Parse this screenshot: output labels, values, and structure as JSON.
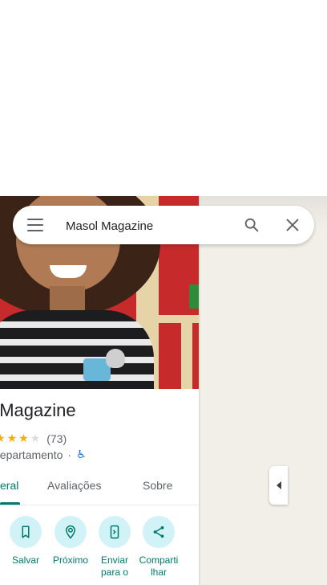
{
  "search": {
    "query": "Masol Magazine",
    "menu_icon": "hamburger-menu-icon",
    "search_icon": "search-icon",
    "clear_icon": "close-icon"
  },
  "place": {
    "name": "ol Magazine",
    "rating_stars": [
      1,
      1,
      1,
      0
    ],
    "review_count": "(73)",
    "category": "departamento",
    "category_sep": "·",
    "accessibility_icon": "wheelchair-icon"
  },
  "tabs": [
    {
      "label": "eral",
      "active": true
    },
    {
      "label": "Avaliações",
      "active": false
    },
    {
      "label": "Sobre",
      "active": false
    }
  ],
  "actions": [
    {
      "label": "Salvar",
      "icon": "bookmark-icon"
    },
    {
      "label": "Próximo",
      "icon": "nearby-icon"
    },
    {
      "label": "Enviar para o",
      "icon": "send-to-phone-icon"
    },
    {
      "label": "Comparti lhar",
      "icon": "share-icon"
    }
  ],
  "colors": {
    "accent": "#00796b",
    "action_bg": "#d1f3f8",
    "star": "#f9ab00",
    "map_bg": "#f2efe9"
  }
}
